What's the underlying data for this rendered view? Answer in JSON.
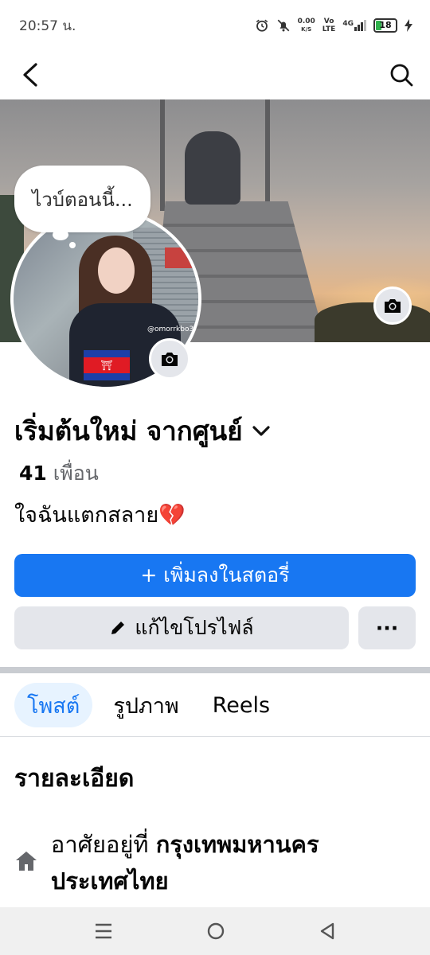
{
  "status_bar": {
    "time": "20:57 น.",
    "net_speed": "0.00",
    "net_unit": "K/S",
    "volte_top": "Vo",
    "volte_bottom": "LTE",
    "signal_label": "4G",
    "battery": "18"
  },
  "cover": {
    "bubble_text": "ไวบ์ตอนนี้...",
    "avatar_watermark": "@omorrkbo3"
  },
  "profile": {
    "name": "เริ่มต้นใหม่ จากศูนย์",
    "friends_count": "41",
    "friends_label": "เพื่อน",
    "bio": "ใจฉันแตกสลาย💔"
  },
  "actions": {
    "add_story": "+ เพิ่มลงในสตอรี่",
    "edit_profile": "แก้ไขโปรไฟล์",
    "more": "···"
  },
  "tabs": [
    {
      "label": "โพสต์",
      "active": true
    },
    {
      "label": "รูปภาพ",
      "active": false
    },
    {
      "label": "Reels",
      "active": false
    }
  ],
  "details": {
    "title": "รายละเอียด",
    "lives_in_prefix": "อาศัยอยู่ที่",
    "lives_in_value": "กรุงเทพมหานคร ประเทศไทย"
  },
  "colors": {
    "accent": "#1877f2",
    "button_gray": "#e4e6eb"
  }
}
